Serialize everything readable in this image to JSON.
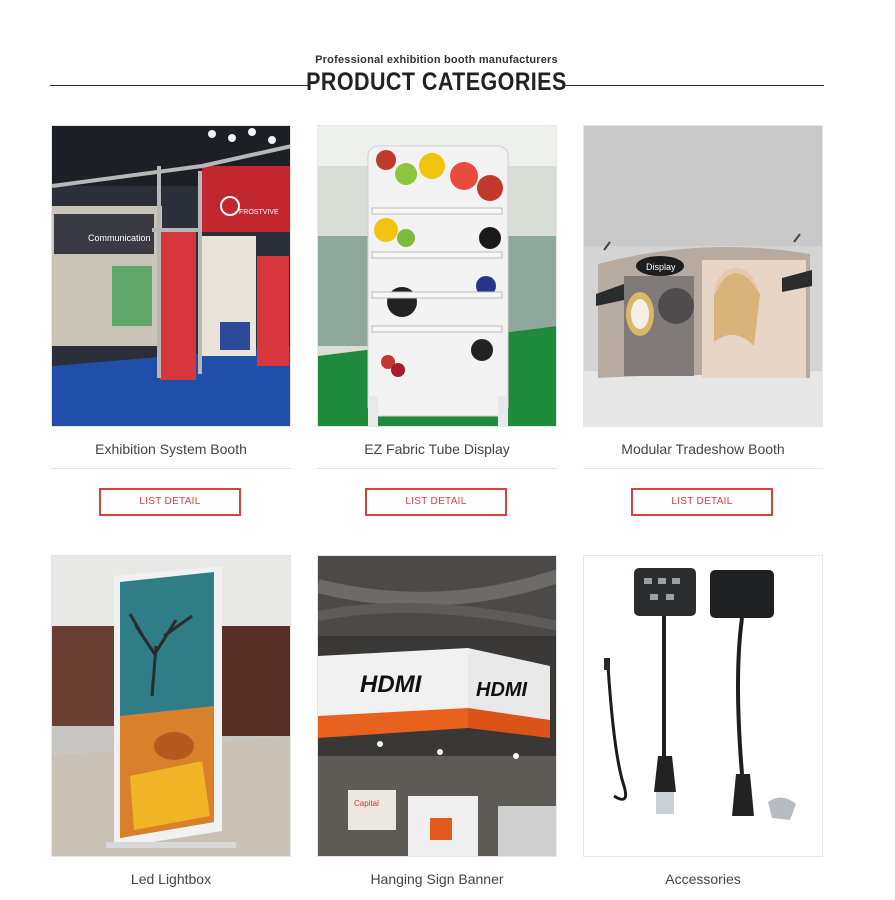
{
  "section": {
    "subtitle": "Professional exhibition booth manufacturers",
    "title": "PRODUCT CATEGORIES"
  },
  "products": [
    {
      "name": "Exhibition System Booth",
      "button": "LIST DETAIL",
      "image_text": [
        "Communication",
        "FROSTVIVE"
      ]
    },
    {
      "name": "EZ Fabric Tube Display",
      "button": "LIST DETAIL"
    },
    {
      "name": "Modular Tradeshow Booth",
      "button": "LIST DETAIL",
      "image_text": [
        "Display"
      ]
    },
    {
      "name": "Led Lightbox"
    },
    {
      "name": "Hanging Sign Banner",
      "image_text": [
        "HDMI",
        "HDMI",
        "Capital"
      ]
    },
    {
      "name": "Accessories"
    }
  ],
  "colors": {
    "accent": "#d9413a",
    "text": "#444444",
    "rule": "#333333"
  }
}
